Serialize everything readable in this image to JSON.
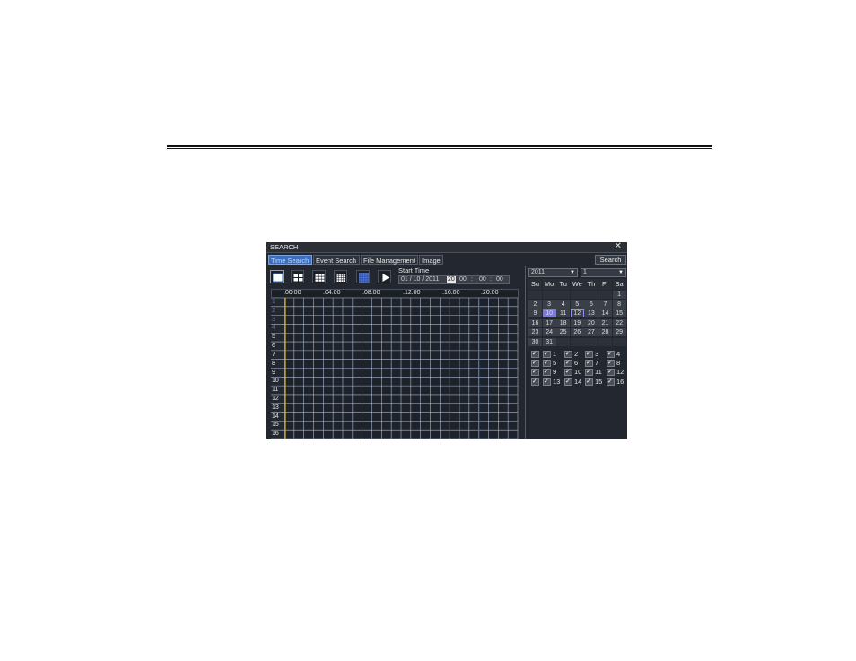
{
  "window": {
    "title": "SEARCH",
    "close_glyph": "✕"
  },
  "tabs": [
    {
      "label": "Time Search",
      "active": true
    },
    {
      "label": "Event Search",
      "active": false
    },
    {
      "label": "File Management",
      "active": false
    },
    {
      "label": "Image",
      "active": false
    }
  ],
  "search_button": "Search",
  "toolbar": {
    "buttons": [
      "single-view-icon",
      "quad-view-icon",
      "nine-view-icon",
      "sixteen-view-icon",
      "grid-view-icon",
      "play-icon"
    ]
  },
  "start_time": {
    "label": "Start Time",
    "date": "01 / 10 / 2011",
    "hour": "20",
    "minute": "00",
    "second": "00",
    "sep": ":"
  },
  "timeline": {
    "hours": [
      ":00:00",
      ":04:00",
      ":08:00",
      ":12:00",
      ":16:00",
      ":20:00"
    ],
    "channels": [
      "1",
      "2",
      "3",
      "4",
      "5",
      "6",
      "7",
      "8",
      "9",
      "10",
      "11",
      "12",
      "13",
      "14",
      "15",
      "16"
    ],
    "dim_channels": [
      1,
      2,
      3,
      4
    ]
  },
  "calendar": {
    "year": "2011",
    "month": "1",
    "weekdays": [
      "Su",
      "Mo",
      "Tu",
      "We",
      "Th",
      "Fr",
      "Sa"
    ],
    "first_weekday": 6,
    "days_in_month": 31,
    "current_day": 10,
    "marked_day": 12
  },
  "channel_select": {
    "rows": [
      [
        "",
        "1",
        "2",
        "3",
        "4"
      ],
      [
        "",
        "5",
        "6",
        "7",
        "8"
      ],
      [
        "",
        "9",
        "10",
        "11",
        "12"
      ],
      [
        "",
        "13",
        "14",
        "15",
        "16"
      ]
    ]
  },
  "colors": {
    "accent": "#3d6fbf",
    "grid_line": "#a8b8d0",
    "cursor_line": "#d8b030",
    "marker_line": "#4a70d0"
  }
}
